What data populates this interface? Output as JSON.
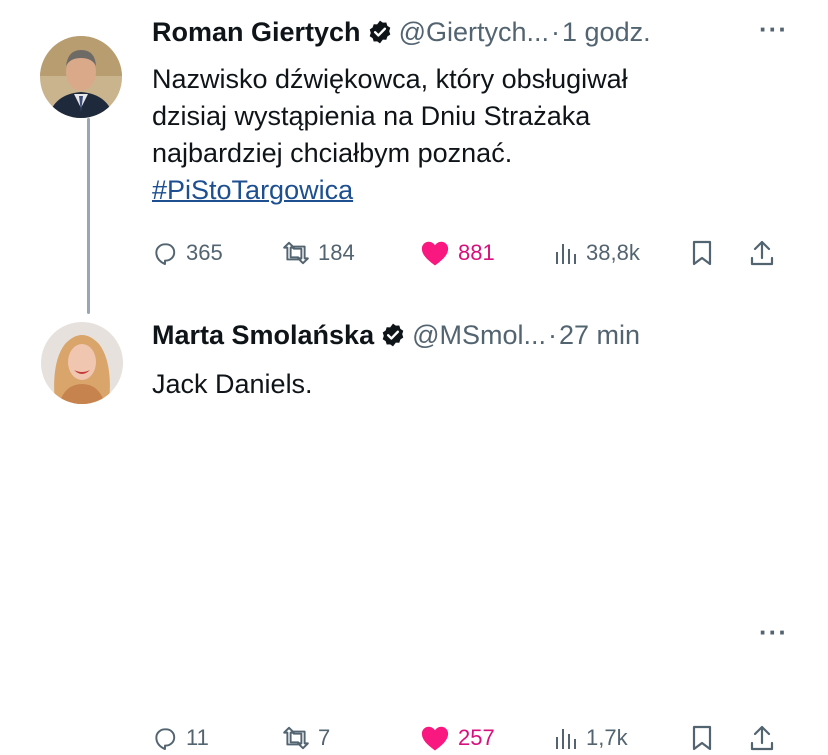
{
  "tweets": [
    {
      "name": "Roman Giertych",
      "handle": "@Giertych...",
      "time": "1 godz.",
      "separator": "·",
      "text_lines": [
        "Nazwisko dźwiękowca, który obsługiwał",
        "dzisiaj wystąpienia na Dniu Strażaka",
        "najbardziej chciałbym poznać."
      ],
      "hashtag": "#PiStoTargowica",
      "replies": "365",
      "retweets": "184",
      "likes": "881",
      "views": "38,8k"
    },
    {
      "name": "Marta Smolańska",
      "handle": "@MSmol...",
      "time": "27 min",
      "separator": "·",
      "text": "Jack Daniels.",
      "replies": "11",
      "retweets": "7",
      "likes": "257",
      "views": "1,7k"
    }
  ],
  "more_label": "···",
  "colors": {
    "verified": "#1d9bf0",
    "like": "#f91880",
    "hashtag": "#1d4f91",
    "muted": "#536471",
    "thread_line": "#9aa6b1"
  },
  "icons": [
    "verified-badge-icon",
    "reply-icon",
    "retweet-icon",
    "heart-icon",
    "views-icon",
    "bookmark-icon",
    "share-icon",
    "more-icon"
  ]
}
